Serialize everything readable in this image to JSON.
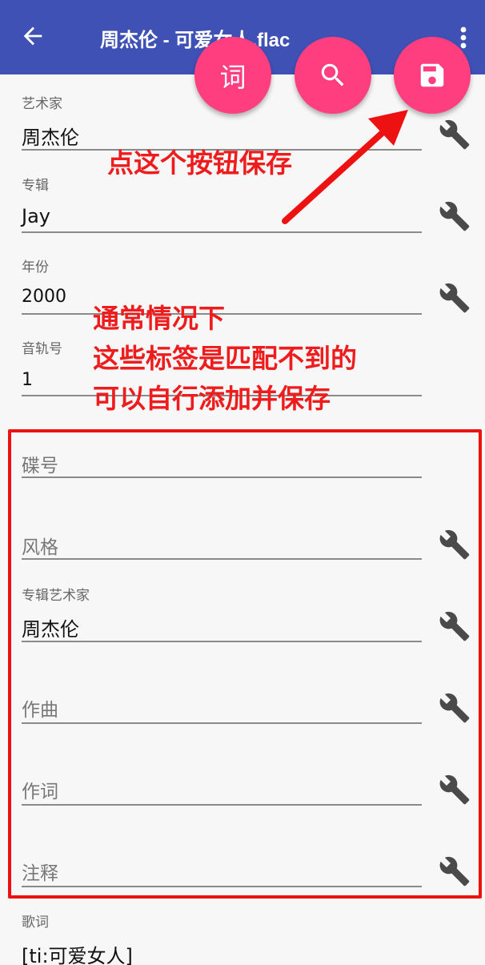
{
  "appbar": {
    "title": "周杰伦 - 可爱女人.flac",
    "back_icon": "arrow-left-icon",
    "more_icon": "more-vert-icon",
    "background": "#3f51b5"
  },
  "fabs": {
    "lyrics_label": "词",
    "search_icon": "search-icon",
    "save_icon": "save-icon",
    "color": "#ff3e7f"
  },
  "fields": {
    "artist": {
      "label": "艺术家",
      "value": "周杰伦"
    },
    "album": {
      "label": "专辑",
      "value": "Jay"
    },
    "year": {
      "label": "年份",
      "value": "2000"
    },
    "track": {
      "label": "音轨号",
      "value": "1"
    },
    "disc": {
      "placeholder": "碟号"
    },
    "genre": {
      "placeholder": "风格"
    },
    "album_artist": {
      "label": "专辑艺术家",
      "value": "周杰伦"
    },
    "composer": {
      "placeholder": "作曲"
    },
    "lyricist": {
      "placeholder": "作词"
    },
    "comment": {
      "placeholder": "注释"
    },
    "lyrics": {
      "label": "歌词",
      "value": "[ti:可爱女人]"
    }
  },
  "annotations": {
    "save_hint": "点这个按钮保存",
    "tag_hint_line1": "通常情况下",
    "tag_hint_line2": "这些标签是匹配不到的",
    "tag_hint_line3": "可以自行添加并保存",
    "color": "#ee1c1c"
  },
  "wrench_icon": "wrench-icon"
}
